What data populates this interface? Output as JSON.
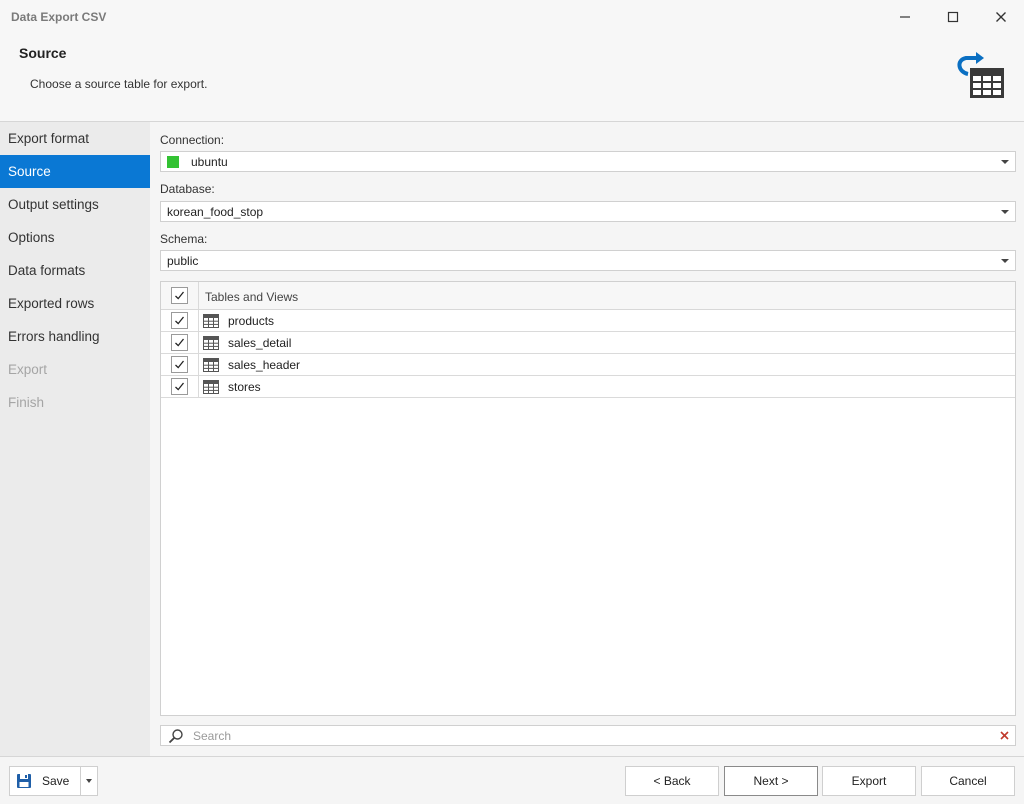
{
  "window": {
    "title": "Data Export CSV",
    "controls": [
      "minimize-icon",
      "maximize-icon",
      "close-icon"
    ]
  },
  "header": {
    "title": "Source",
    "description": "Choose a source table for export.",
    "icon": "table-export-icon"
  },
  "sidebar": {
    "items": [
      {
        "label": "Export format",
        "state": "normal"
      },
      {
        "label": "Source",
        "state": "active"
      },
      {
        "label": "Output settings",
        "state": "normal"
      },
      {
        "label": "Options",
        "state": "normal"
      },
      {
        "label": "Data formats",
        "state": "normal"
      },
      {
        "label": "Exported rows",
        "state": "normal"
      },
      {
        "label": "Errors handling",
        "state": "normal"
      },
      {
        "label": "Export",
        "state": "disabled"
      },
      {
        "label": "Finish",
        "state": "disabled"
      }
    ]
  },
  "form": {
    "connection_label": "Connection:",
    "connection_value": "ubuntu",
    "connection_color": "#33c233",
    "database_label": "Database:",
    "database_value": "korean_food_stop",
    "schema_label": "Schema:",
    "schema_value": "public"
  },
  "grid": {
    "header_label": "Tables and Views",
    "header_checked": true,
    "rows": [
      {
        "name": "products",
        "checked": true
      },
      {
        "name": "sales_detail",
        "checked": true
      },
      {
        "name": "sales_header",
        "checked": true
      },
      {
        "name": "stores",
        "checked": true
      }
    ]
  },
  "search": {
    "placeholder": "Search",
    "value": ""
  },
  "footer": {
    "save_label": "Save",
    "back_label": "< Back",
    "next_label": "Next >",
    "export_label": "Export",
    "cancel_label": "Cancel"
  },
  "colors": {
    "accent": "#0a78d4",
    "clear_icon": "#c0392b"
  }
}
